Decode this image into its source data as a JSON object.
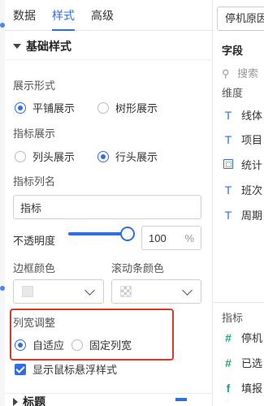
{
  "tabs": [
    {
      "label": "数据"
    },
    {
      "label": "样式"
    },
    {
      "label": "高级"
    }
  ],
  "active_tab": "样式",
  "basic_style": {
    "title": "基础样式",
    "display_form": {
      "label": "展示形式",
      "options": [
        "平铺展示",
        "树形展示"
      ],
      "selected": "平铺展示"
    },
    "metric_display": {
      "label": "指标展示",
      "options": [
        "列头展示",
        "行头展示"
      ],
      "selected": "行头展示"
    },
    "metric_col_name": {
      "label": "指标列名",
      "value": "指标"
    },
    "opacity": {
      "label": "不透明度",
      "value": "100",
      "unit": "%",
      "level": 1.0
    },
    "border_color": {
      "label": "边框颜色"
    },
    "scrollbar_color": {
      "label": "滚动条颜色"
    },
    "col_width": {
      "label": "列宽调整",
      "options": [
        "自适应",
        "固定列宽"
      ],
      "selected": "自适应"
    },
    "hover_style": {
      "label": "显示鼠标悬浮样式",
      "checked": true
    }
  },
  "next_section": {
    "title": "标题"
  },
  "right_panel": {
    "dataset": "停机原因",
    "fields_title": "字段",
    "search_placeholder": "搜索",
    "dimensions_label": "维度",
    "dimensions": [
      {
        "icon": "text-icon",
        "label": "线体"
      },
      {
        "icon": "text-icon",
        "label": "项目"
      },
      {
        "icon": "calendar-icon",
        "label": "统计"
      },
      {
        "icon": "text-icon",
        "label": "班次"
      },
      {
        "icon": "text-icon",
        "label": "周期"
      }
    ],
    "metrics_label": "指标",
    "metrics": [
      {
        "icon": "hash-icon",
        "label": "停机"
      },
      {
        "icon": "hash-icon",
        "label": "已选"
      },
      {
        "icon": "formula-icon",
        "label": "填报"
      }
    ]
  }
}
